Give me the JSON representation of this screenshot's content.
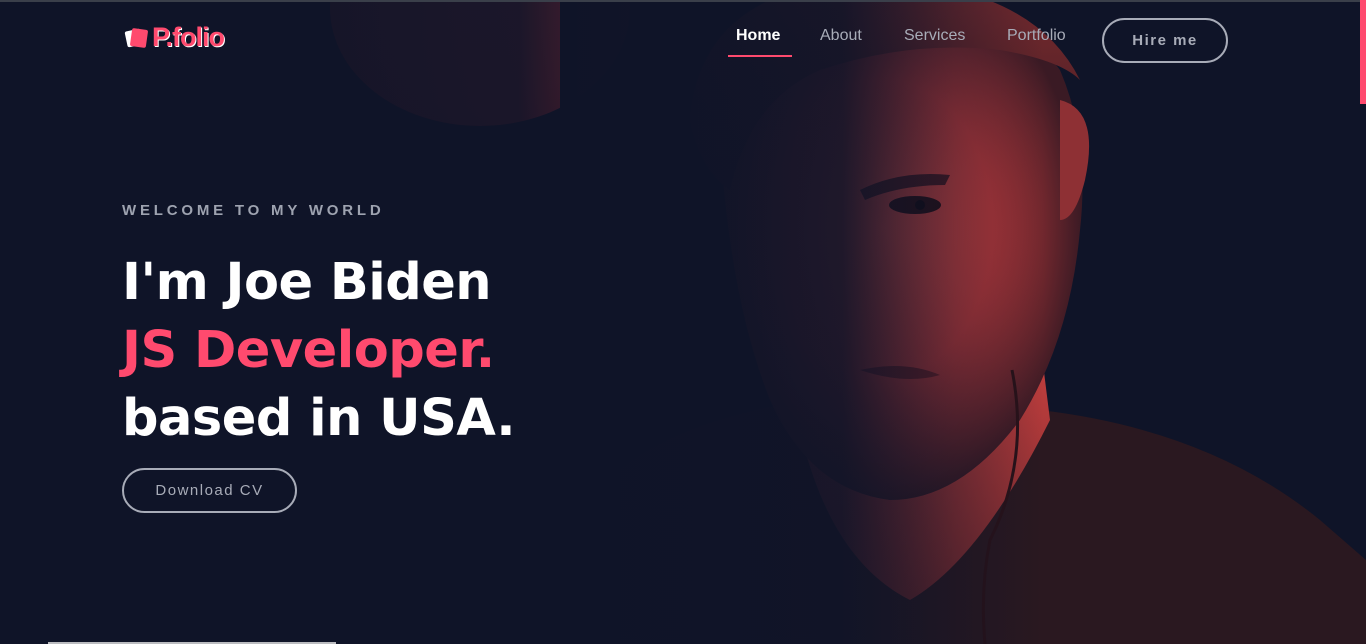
{
  "brand": {
    "logo_text": "P.folio",
    "accent": "#ff4a6e",
    "background": "#0f1428"
  },
  "nav": {
    "items": [
      {
        "label": "Home",
        "active": true
      },
      {
        "label": "About",
        "active": false
      },
      {
        "label": "Services",
        "active": false
      },
      {
        "label": "Portfolio",
        "active": false
      }
    ],
    "cta_label": "Hire me"
  },
  "hero": {
    "kicker": "WELCOME TO MY WORLD",
    "line1": "I'm Joe Biden",
    "line2": "JS Developer.",
    "line3": "based in USA.",
    "cv_button": "Download CV"
  }
}
